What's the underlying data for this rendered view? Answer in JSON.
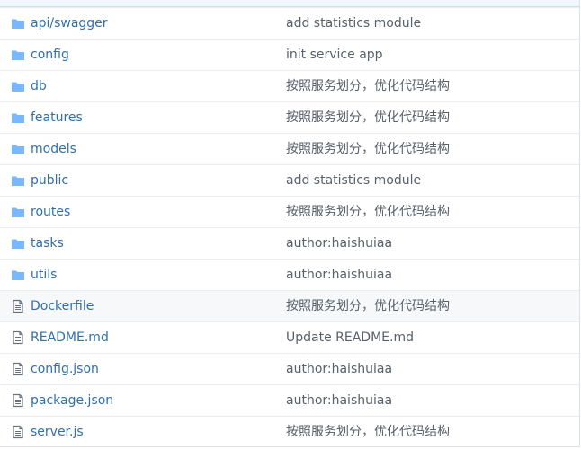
{
  "files": [
    {
      "name": "api/swagger",
      "type": "folder",
      "icon": "folder-icon",
      "message": "add statistics module"
    },
    {
      "name": "config",
      "type": "folder",
      "icon": "folder-icon",
      "message": "init service app"
    },
    {
      "name": "db",
      "type": "folder",
      "icon": "folder-icon",
      "message": "按照服务划分，优化代码结构"
    },
    {
      "name": "features",
      "type": "folder",
      "icon": "folder-icon",
      "message": "按照服务划分，优化代码结构"
    },
    {
      "name": "models",
      "type": "folder",
      "icon": "folder-icon",
      "message": "按照服务划分，优化代码结构"
    },
    {
      "name": "public",
      "type": "folder",
      "icon": "folder-icon",
      "message": "add statistics module"
    },
    {
      "name": "routes",
      "type": "folder",
      "icon": "folder-icon",
      "message": "按照服务划分，优化代码结构"
    },
    {
      "name": "tasks",
      "type": "folder",
      "icon": "folder-icon",
      "message": "author:haishuiaa"
    },
    {
      "name": "utils",
      "type": "folder",
      "icon": "folder-icon",
      "message": "author:haishuiaa"
    },
    {
      "name": "Dockerfile",
      "type": "file",
      "icon": "file-icon",
      "message": "按照服务划分，优化代码结构"
    },
    {
      "name": "README.md",
      "type": "file",
      "icon": "file-icon",
      "message": "Update README.md"
    },
    {
      "name": "config.json",
      "type": "file",
      "icon": "file-icon",
      "message": "author:haishuiaa"
    },
    {
      "name": "package.json",
      "type": "file",
      "icon": "file-icon",
      "message": "author:haishuiaa"
    },
    {
      "name": "server.js",
      "type": "file",
      "icon": "file-icon",
      "message": "按照服务划分，优化代码结构"
    }
  ],
  "colors": {
    "link": "#2f6fae",
    "folder_icon": "#79b8ff",
    "file_icon": "#6a737d",
    "message_text": "#586069",
    "row_border": "#eaecef",
    "highlight_row": "#f6f8fa"
  }
}
